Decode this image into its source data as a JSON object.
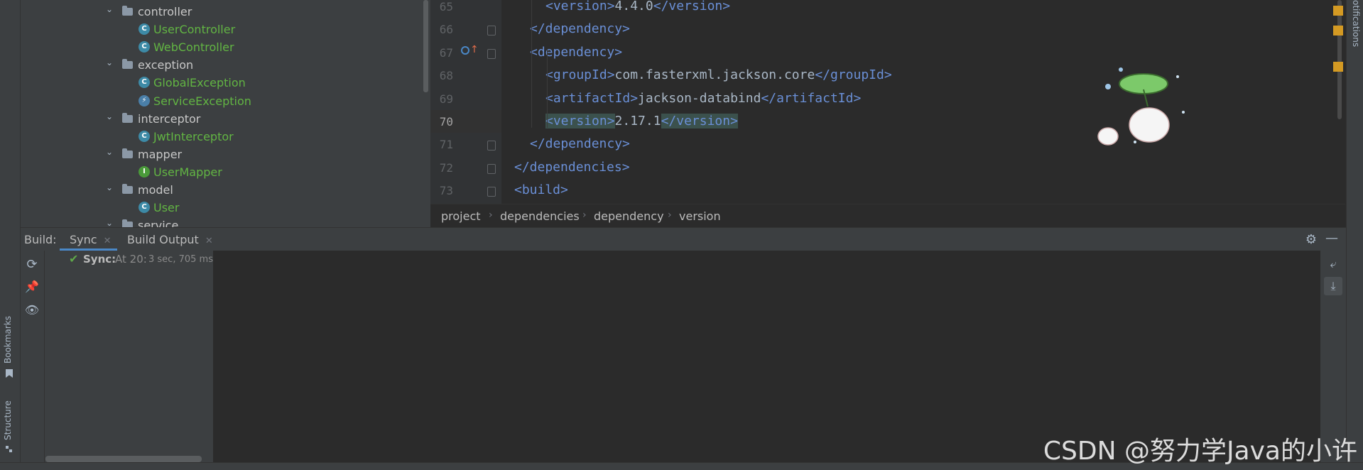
{
  "left_tool_strip": {
    "bookmarks_label": "Bookmarks",
    "structure_label": "Structure"
  },
  "right_tool_strip": {
    "notifications_label": "otifications"
  },
  "project_tree": {
    "items": [
      {
        "label": "controller",
        "kind": "folder"
      },
      {
        "label": "UserController",
        "kind": "class",
        "icon_letter": "C"
      },
      {
        "label": "WebController",
        "kind": "class",
        "icon_letter": "C"
      },
      {
        "label": "exception",
        "kind": "folder"
      },
      {
        "label": "GlobalException",
        "kind": "class",
        "icon_letter": "C"
      },
      {
        "label": "ServiceException",
        "kind": "exception",
        "icon_letter": "⚡"
      },
      {
        "label": "interceptor",
        "kind": "folder"
      },
      {
        "label": "JwtInterceptor",
        "kind": "class",
        "icon_letter": "C"
      },
      {
        "label": "mapper",
        "kind": "folder"
      },
      {
        "label": "UserMapper",
        "kind": "interface",
        "icon_letter": "I"
      },
      {
        "label": "model",
        "kind": "folder"
      },
      {
        "label": "User",
        "kind": "class",
        "icon_letter": "C"
      },
      {
        "label": "service",
        "kind": "folder"
      }
    ]
  },
  "editor": {
    "line_numbers": [
      "65",
      "66",
      "67",
      "68",
      "69",
      "70",
      "71",
      "72",
      "73"
    ],
    "current_line": "70",
    "lines": [
      {
        "open": "<version>",
        "text": "4.4.0",
        "close": "</version>"
      },
      {
        "open": "",
        "text": "",
        "close": "</dependency>"
      },
      {
        "open": "<dependency>",
        "text": "",
        "close": ""
      },
      {
        "open": "<groupId>",
        "text": "com.fasterxml.jackson.core",
        "close": "</groupId>"
      },
      {
        "open": "<artifactId>",
        "text": "jackson-databind",
        "close": "</artifactId>"
      },
      {
        "open": "<version>",
        "text": "2.17.1",
        "close": "</version>"
      },
      {
        "open": "",
        "text": "",
        "close": "</dependency>"
      },
      {
        "open": "",
        "text": "",
        "close": "</dependencies>"
      },
      {
        "open": "<build>",
        "text": "",
        "close": ""
      }
    ]
  },
  "breadcrumb": [
    "project",
    "dependencies",
    "dependency",
    "version"
  ],
  "build_window": {
    "title": "Build:",
    "tabs": [
      {
        "label": "Sync",
        "active": true
      },
      {
        "label": "Build Output",
        "active": false
      }
    ],
    "tree": {
      "status_label": "Sync:",
      "status_text": "At 20:",
      "duration": "3 sec, 705 ms"
    }
  },
  "watermark": "CSDN @努力学Java的小许",
  "colors": {
    "accent": "#4a88c7",
    "marker": "#d49a23",
    "class_text": "#62b543",
    "tag": "#e8bf6a"
  }
}
